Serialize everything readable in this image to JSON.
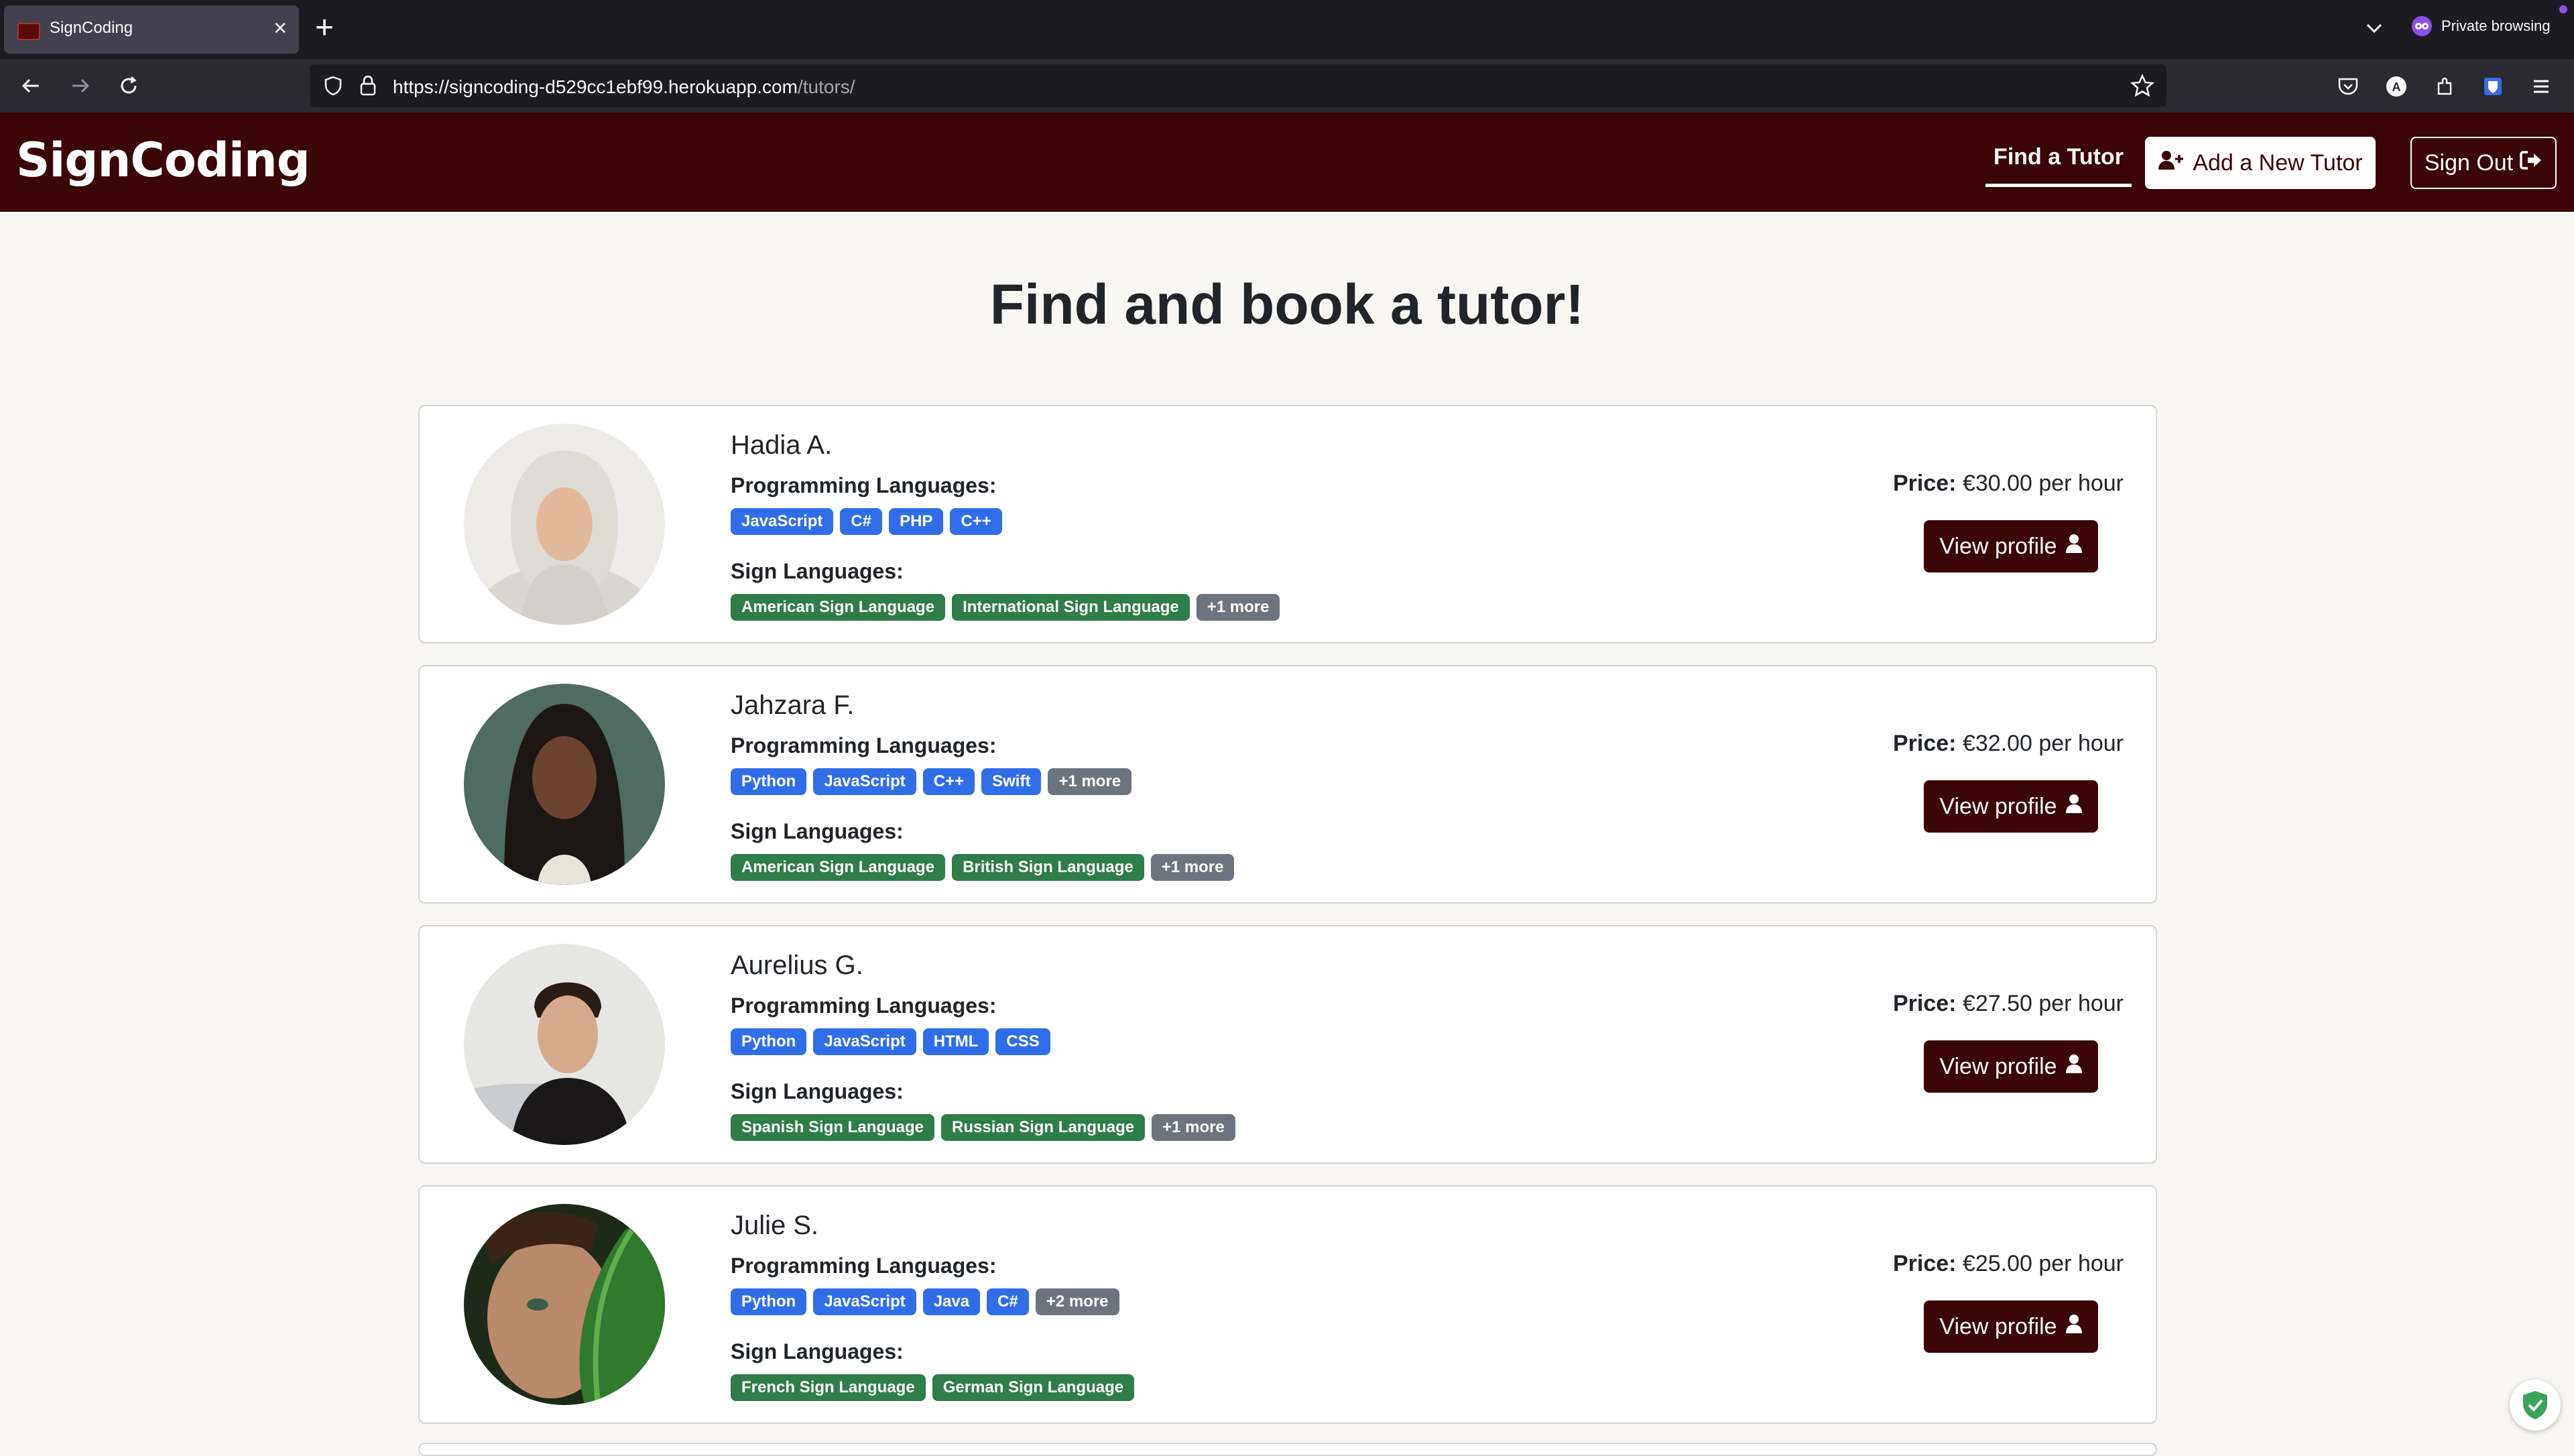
{
  "browser": {
    "tab_title": "SignCoding",
    "tab_close": "×",
    "new_tab": "+",
    "private_label": "Private browsing",
    "url_main": "https://signcoding-d529cc1ebf99.herokuapp.com",
    "url_path": "/tutors/"
  },
  "header": {
    "logo": "SignCoding",
    "nav_find": "Find a Tutor",
    "add_tutor": "Add a New Tutor",
    "sign_out": "Sign Out"
  },
  "page": {
    "title": "Find and book a tutor!"
  },
  "labels": {
    "programming": "Programming Languages:",
    "sign": "Sign Languages:",
    "price": "Price:",
    "view_profile": "View profile"
  },
  "tutors": [
    {
      "name": "Hadia A.",
      "price": "€30.00 per hour",
      "programming": [
        "JavaScript",
        "C#",
        "PHP",
        "C++"
      ],
      "sign": [
        "American Sign Language",
        "International Sign Language"
      ],
      "sign_more": "+1 more"
    },
    {
      "name": "Jahzara F.",
      "price": "€32.00 per hour",
      "programming": [
        "Python",
        "JavaScript",
        "C++",
        "Swift"
      ],
      "programming_more": "+1 more",
      "sign": [
        "American Sign Language",
        "British Sign Language"
      ],
      "sign_more": "+1 more"
    },
    {
      "name": "Aurelius G.",
      "price": "€27.50 per hour",
      "programming": [
        "Python",
        "JavaScript",
        "HTML",
        "CSS"
      ],
      "sign": [
        "Spanish Sign Language",
        "Russian Sign Language"
      ],
      "sign_more": "+1 more"
    },
    {
      "name": "Julie S.",
      "price": "€25.00 per hour",
      "programming": [
        "Python",
        "JavaScript",
        "Java",
        "C#"
      ],
      "programming_more": "+2 more",
      "sign": [
        "French Sign Language",
        "German Sign Language"
      ]
    }
  ]
}
